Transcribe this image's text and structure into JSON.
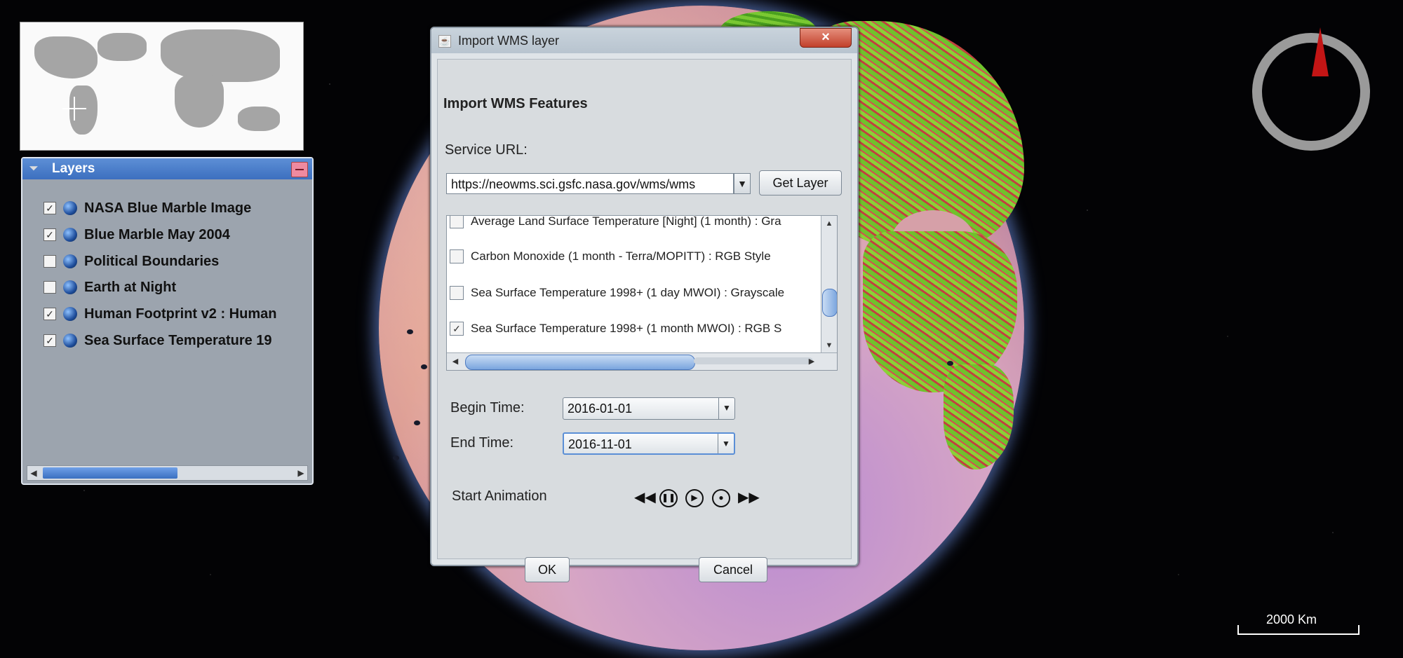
{
  "overview": {
    "crosshair": "crosshair-icon"
  },
  "layers_panel": {
    "title": "Layers",
    "items": [
      {
        "label": "NASA Blue Marble Image",
        "checked": true
      },
      {
        "label": "Blue Marble May 2004",
        "checked": true
      },
      {
        "label": "Political Boundaries",
        "checked": false
      },
      {
        "label": "Earth at Night",
        "checked": false
      },
      {
        "label": "Human Footprint v2 : Human",
        "checked": true
      },
      {
        "label": "Sea Surface Temperature 19",
        "checked": true
      }
    ]
  },
  "dialog": {
    "window_title": "Import WMS layer",
    "close_label": "×",
    "heading": "Import WMS Features",
    "service_url_label": "Service URL:",
    "service_url_value": "https://neowms.sci.gsfc.nasa.gov/wms/wms",
    "get_layer_label": "Get Layer",
    "layer_list": [
      {
        "label": "Average Land Surface Temperature [Night] (1 month) : Gra",
        "checked": false
      },
      {
        "label": "Carbon Monoxide (1 month - Terra/MOPITT) : RGB Style",
        "checked": false
      },
      {
        "label": "Sea Surface Temperature 1998+ (1 day MWOI) : Grayscale",
        "checked": false
      },
      {
        "label": "Sea Surface Temperature 1998+ (1 month MWOI) : RGB S",
        "checked": true
      }
    ],
    "begin_time_label": "Begin Time:",
    "begin_time_value": "2016-01-01",
    "end_time_label": "End Time:",
    "end_time_value": "2016-11-01",
    "start_animation_label": "Start Animation",
    "ok_label": "OK",
    "cancel_label": "Cancel"
  },
  "scale": {
    "label": "2000 Km"
  },
  "check_mark": "✓"
}
